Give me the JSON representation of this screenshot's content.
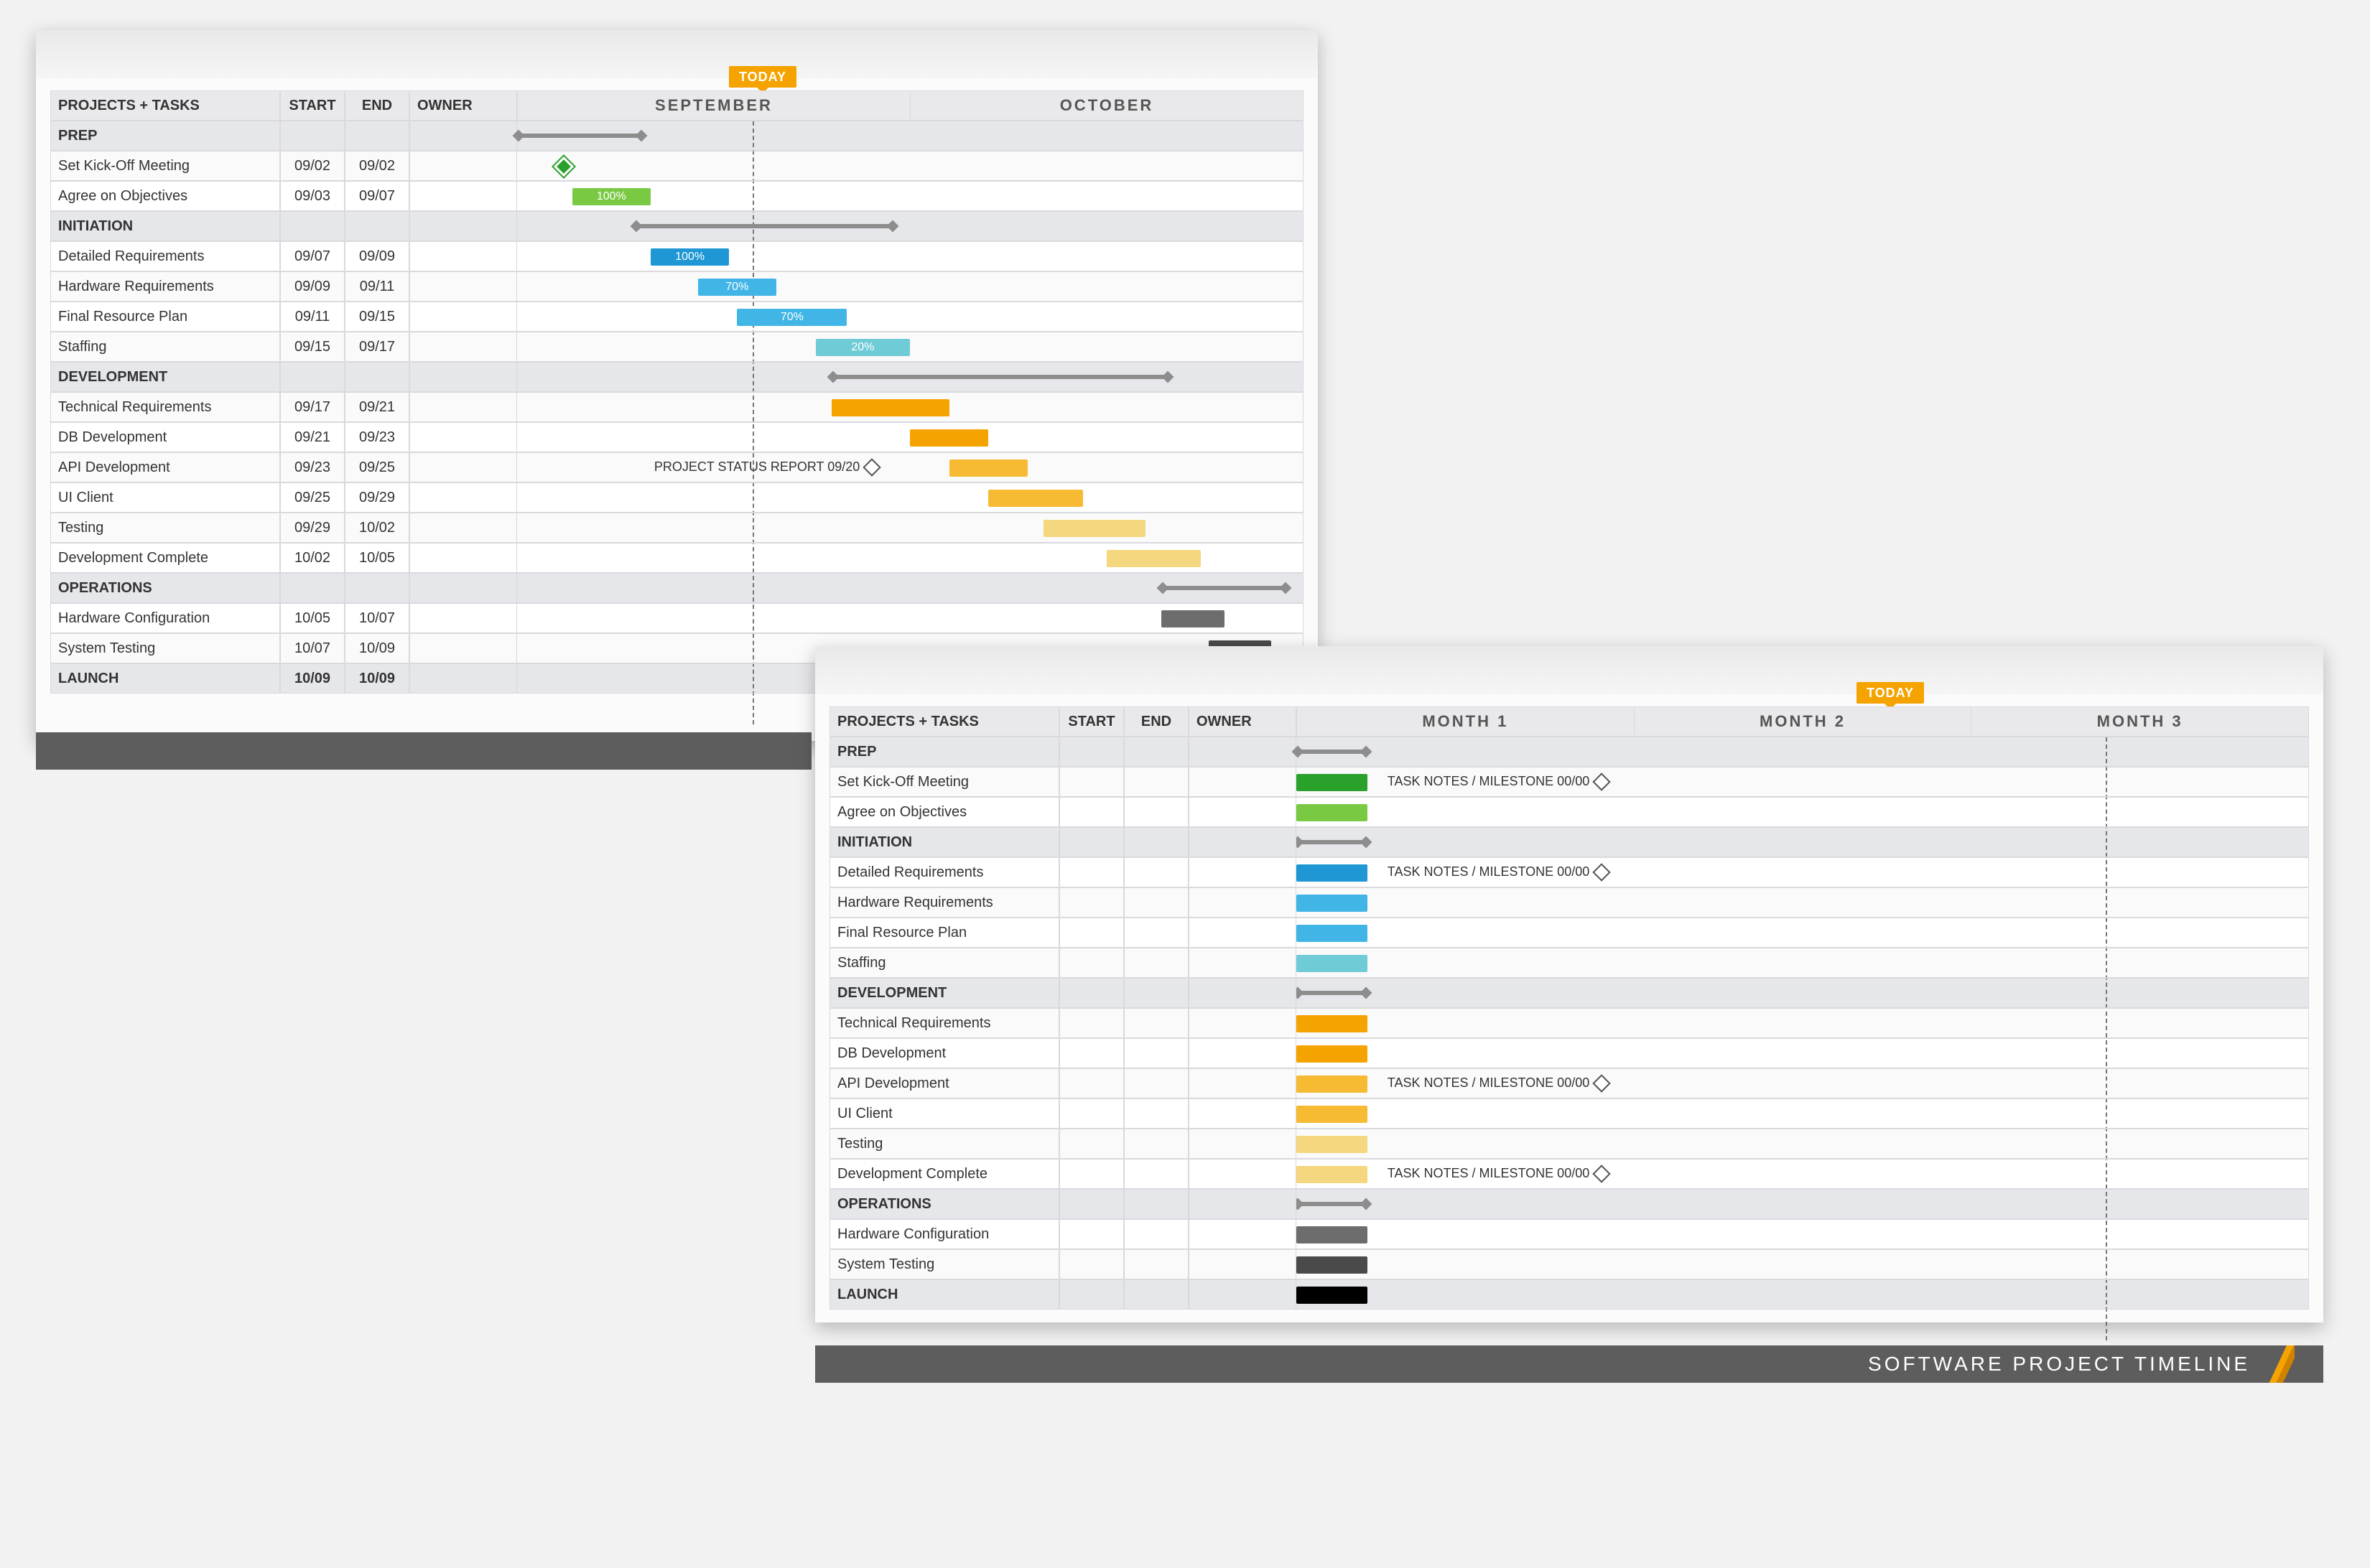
{
  "title": "SOFTWARE PROJECT TIMELINE",
  "today_label": "TODAY",
  "columns": {
    "task": "PROJECTS + TASKS",
    "start": "START",
    "end": "END",
    "owner": "OWNER"
  },
  "chart1": {
    "months": [
      "SEPTEMBER",
      "OCTOBER"
    ],
    "today_pct": 30,
    "milestone_note": "PROJECT STATUS REPORT  09/20",
    "rows": [
      {
        "type": "section",
        "task": "PREP",
        "summary": [
          0,
          16
        ]
      },
      {
        "task": "Set Kick-Off Meeting",
        "start": "09/02",
        "end": "09/02",
        "milestone_pct": 5,
        "ms_class": "green"
      },
      {
        "task": "Agree on Objectives",
        "start": "09/03",
        "end": "09/07",
        "bar": [
          7,
          17
        ],
        "cls": "c-green2",
        "label": "100%"
      },
      {
        "type": "section",
        "task": "INITIATION",
        "summary": [
          15,
          48
        ]
      },
      {
        "task": "Detailed Requirements",
        "start": "09/07",
        "end": "09/09",
        "bar": [
          17,
          27
        ],
        "cls": "c-blue1",
        "label": "100%"
      },
      {
        "task": "Hardware Requirements",
        "start": "09/09",
        "end": "09/11",
        "bar": [
          23,
          33
        ],
        "cls": "c-blue2",
        "label": "70%"
      },
      {
        "task": "Final Resource Plan",
        "start": "09/11",
        "end": "09/15",
        "bar": [
          28,
          42
        ],
        "cls": "c-blue2",
        "label": "70%"
      },
      {
        "task": "Staffing",
        "start": "09/15",
        "end": "09/17",
        "bar": [
          38,
          50
        ],
        "cls": "c-blue3",
        "label": "20%"
      },
      {
        "type": "section",
        "task": "DEVELOPMENT",
        "summary": [
          40,
          83
        ]
      },
      {
        "task": "Technical Requirements",
        "start": "09/17",
        "end": "09/21",
        "bar": [
          40,
          55
        ],
        "cls": "c-or1"
      },
      {
        "task": "DB Development",
        "start": "09/21",
        "end": "09/23",
        "bar": [
          50,
          60
        ],
        "cls": "c-or1"
      },
      {
        "task": "API Development",
        "start": "09/23",
        "end": "09/25",
        "bar": [
          55,
          65
        ],
        "cls": "c-or2",
        "note_at": 46
      },
      {
        "task": "UI Client",
        "start": "09/25",
        "end": "09/29",
        "bar": [
          60,
          72
        ],
        "cls": "c-or2"
      },
      {
        "task": "Testing",
        "start": "09/29",
        "end": "10/02",
        "bar": [
          67,
          80
        ],
        "cls": "c-or3"
      },
      {
        "task": "Development Complete",
        "start": "10/02",
        "end": "10/05",
        "bar": [
          75,
          87
        ],
        "cls": "c-or3"
      },
      {
        "type": "section",
        "task": "OPERATIONS",
        "summary": [
          82,
          98
        ]
      },
      {
        "task": "Hardware Configuration",
        "start": "10/05",
        "end": "10/07",
        "bar": [
          82,
          90
        ],
        "cls": "c-gray"
      },
      {
        "task": "System Testing",
        "start": "10/07",
        "end": "10/09",
        "bar": [
          88,
          96
        ],
        "cls": "c-dgray"
      },
      {
        "type": "section",
        "task": "LAUNCH",
        "start": "10/09",
        "end": "10/09"
      }
    ]
  },
  "chart2": {
    "months": [
      "MONTH 1",
      "MONTH 2",
      "MONTH 3"
    ],
    "today_pct": 80,
    "note_text": "TASK NOTES / MILESTONE 00/00",
    "rows": [
      {
        "type": "section",
        "task": "PREP",
        "summary": [
          0,
          7
        ]
      },
      {
        "task": "Set Kick-Off Meeting",
        "bar": [
          0,
          7
        ],
        "cls": "c-green1",
        "note": true
      },
      {
        "task": "Agree on Objectives",
        "bar": [
          0,
          7
        ],
        "cls": "c-green2"
      },
      {
        "type": "section",
        "task": "INITIATION",
        "summary": [
          0,
          7
        ]
      },
      {
        "task": "Detailed Requirements",
        "bar": [
          0,
          7
        ],
        "cls": "c-blue1",
        "note": true
      },
      {
        "task": "Hardware Requirements",
        "bar": [
          0,
          7
        ],
        "cls": "c-blue2"
      },
      {
        "task": "Final Resource Plan",
        "bar": [
          0,
          7
        ],
        "cls": "c-blue2"
      },
      {
        "task": "Staffing",
        "bar": [
          0,
          7
        ],
        "cls": "c-blue3"
      },
      {
        "type": "section",
        "task": "DEVELOPMENT",
        "summary": [
          0,
          7
        ]
      },
      {
        "task": "Technical Requirements",
        "bar": [
          0,
          7
        ],
        "cls": "c-or1"
      },
      {
        "task": "DB Development",
        "bar": [
          0,
          7
        ],
        "cls": "c-or1"
      },
      {
        "task": "API Development",
        "bar": [
          0,
          7
        ],
        "cls": "c-or2",
        "note": true
      },
      {
        "task": "UI Client",
        "bar": [
          0,
          7
        ],
        "cls": "c-or2"
      },
      {
        "task": "Testing",
        "bar": [
          0,
          7
        ],
        "cls": "c-or3"
      },
      {
        "task": "Development Complete",
        "bar": [
          0,
          7
        ],
        "cls": "c-or3",
        "note": true
      },
      {
        "type": "section",
        "task": "OPERATIONS",
        "summary": [
          0,
          7
        ]
      },
      {
        "task": "Hardware Configuration",
        "bar": [
          0,
          7
        ],
        "cls": "c-gray"
      },
      {
        "task": "System Testing",
        "bar": [
          0,
          7
        ],
        "cls": "c-dgray"
      },
      {
        "type": "section",
        "task": "LAUNCH",
        "bar": [
          0,
          7
        ],
        "cls": "c-black"
      }
    ]
  }
}
